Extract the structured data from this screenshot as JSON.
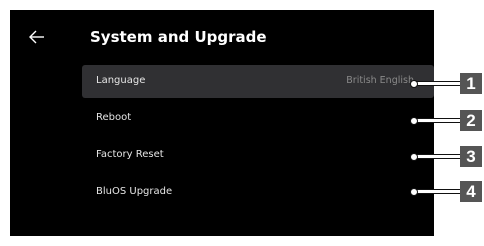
{
  "header": {
    "back_icon": "arrow-left-icon",
    "title": "System and Upgrade"
  },
  "menu": {
    "items": [
      {
        "label": "Language",
        "value": "British English",
        "selected": true
      },
      {
        "label": "Reboot",
        "value": "",
        "selected": false
      },
      {
        "label": "Factory Reset",
        "value": "",
        "selected": false
      },
      {
        "label": "BluOS Upgrade",
        "value": "",
        "selected": false
      }
    ]
  },
  "callouts": [
    "1",
    "2",
    "3",
    "4"
  ],
  "colors": {
    "screen_background": "#000000",
    "selected_row": "#303033",
    "callout_badge": "#555555"
  }
}
